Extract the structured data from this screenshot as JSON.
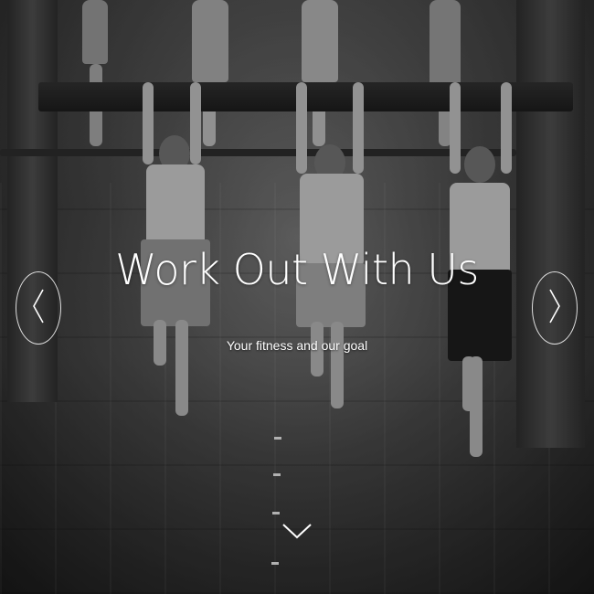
{
  "hero": {
    "title": "Work Out With Us",
    "subtitle": "Your fitness and our goal"
  },
  "navigation": {
    "prev_icon": "chevron-left-icon",
    "next_icon": "chevron-right-icon",
    "scroll_icon": "chevron-down-icon"
  },
  "colors": {
    "text": "#ffffff",
    "overlay": "#000000"
  }
}
